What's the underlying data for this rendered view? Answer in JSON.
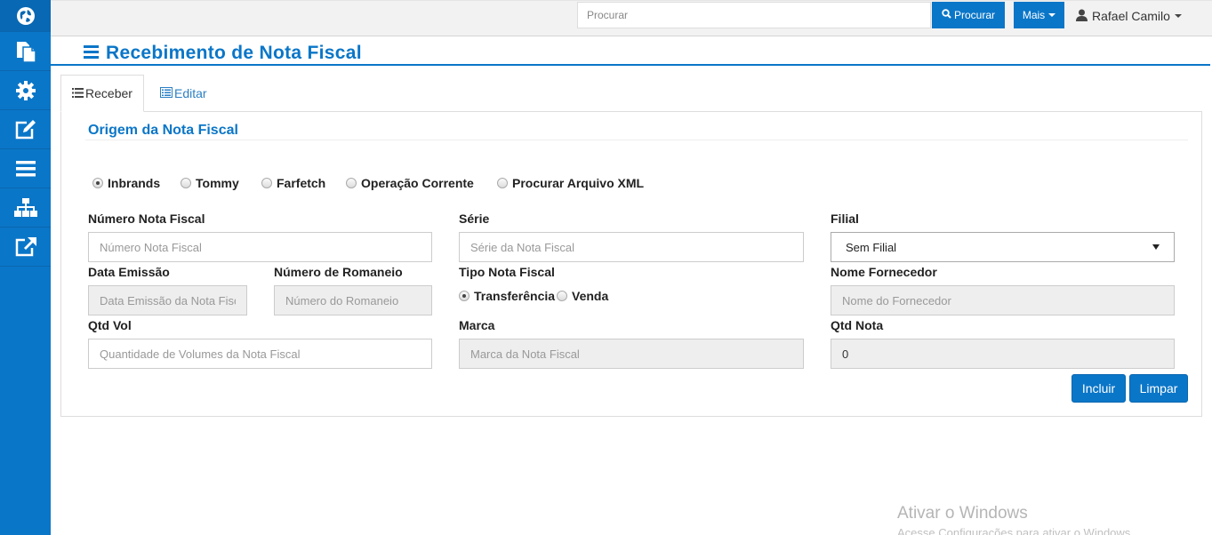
{
  "sidebar": {
    "items": [
      {
        "icon": "globe-icon"
      },
      {
        "icon": "files-icon"
      },
      {
        "icon": "gear-icon"
      },
      {
        "icon": "edit-icon"
      },
      {
        "icon": "bars-icon"
      },
      {
        "icon": "sitemap-icon"
      },
      {
        "icon": "external-link-icon"
      }
    ]
  },
  "topbar": {
    "search_placeholder": "Procurar",
    "search_button": "Procurar",
    "more_button": "Mais",
    "user_name": "Rafael Camilo"
  },
  "page": {
    "title": "Recebimento de Nota Fiscal"
  },
  "tabs": [
    {
      "label": "Receber",
      "active": true
    },
    {
      "label": "Editar",
      "active": false
    }
  ],
  "form": {
    "section_title": "Origem da Nota Fiscal",
    "origin_options": [
      {
        "label": "Inbrands",
        "checked": true
      },
      {
        "label": "Tommy",
        "checked": false
      },
      {
        "label": "Farfetch",
        "checked": false
      },
      {
        "label": "Operação Corrente",
        "checked": false
      },
      {
        "label": "Procurar Arquivo XML",
        "checked": false
      }
    ],
    "numero_nf": {
      "label": "Número Nota Fiscal",
      "placeholder": "Número Nota Fiscal"
    },
    "serie": {
      "label": "Série",
      "placeholder": "Série da Nota Fiscal"
    },
    "filial": {
      "label": "Filial",
      "value": "Sem Filial"
    },
    "data_emissao": {
      "label": "Data Emissão",
      "placeholder": "Data Emissão da Nota Fiscal"
    },
    "numero_romaneio": {
      "label": "Número de Romaneio",
      "placeholder": "Número do Romaneio"
    },
    "tipo_nf": {
      "label": "Tipo Nota Fiscal",
      "options": [
        {
          "label": "Transferência",
          "checked": true
        },
        {
          "label": "Venda",
          "checked": false
        }
      ]
    },
    "nome_fornecedor": {
      "label": "Nome Fornecedor",
      "placeholder": "Nome do Fornecedor"
    },
    "qtd_vol": {
      "label": "Qtd Vol",
      "placeholder": "Quantidade de Volumes da Nota Fiscal"
    },
    "marca": {
      "label": "Marca",
      "placeholder": "Marca da Nota Fiscal"
    },
    "qtd_nota": {
      "label": "Qtd Nota",
      "value": "0"
    },
    "include_button": "Incluir",
    "clear_button": "Limpar"
  },
  "watermark": {
    "title": "Ativar o Windows",
    "subtitle": "Acesse Configurações para ativar o Windows."
  },
  "colors": {
    "primary": "#0a76c8",
    "sidebar": "#0a76c8",
    "topbar": "#f2f2f2"
  }
}
